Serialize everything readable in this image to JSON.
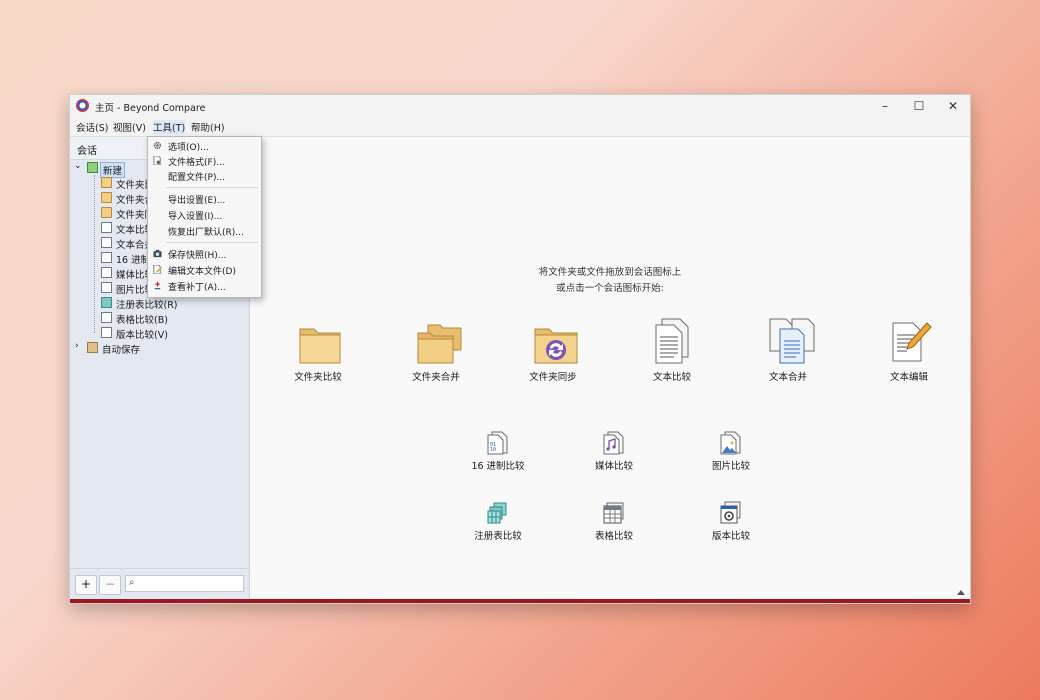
{
  "window": {
    "title": "主页 - Beyond Compare"
  },
  "menubar": {
    "items": [
      "会话(S)",
      "视图(V)",
      "工具(T)",
      "帮助(H)"
    ]
  },
  "tools_menu": {
    "items": [
      {
        "label": "选项(O)...",
        "icon": "gear-icon"
      },
      {
        "label": "文件格式(F)...",
        "icon": "file-format-icon"
      },
      {
        "label": "配置文件(P)...",
        "icon": ""
      },
      {
        "label": "导出设置(E)...",
        "icon": ""
      },
      {
        "label": "导入设置(I)...",
        "icon": ""
      },
      {
        "label": "恢复出厂默认(R)...",
        "icon": ""
      },
      {
        "label": "保存快照(H)...",
        "icon": "camera-icon"
      },
      {
        "label": "编辑文本文件(D)",
        "icon": "edit-file-icon"
      },
      {
        "label": "查看补丁(A)...",
        "icon": "patch-icon"
      }
    ]
  },
  "sidebar": {
    "header": "会话",
    "tree": {
      "new": "新建",
      "items": [
        "文件夹比较",
        "文件夹合并",
        "文件夹同步",
        "文本比较",
        "文本合并",
        "16 进制比较",
        "媒体比较",
        "图片比较",
        "注册表比较(R)",
        "表格比较(B)",
        "版本比较(V)"
      ],
      "autosave": "自动保存"
    },
    "add_label": "+",
    "remove_label": "−",
    "search_placeholder": ""
  },
  "main": {
    "hint_line1": "将文件夹或文件拖放到会话图标上",
    "hint_line2": "或点击一个会话图标开始:",
    "large_sessions": [
      "文件夹比较",
      "文件夹合并",
      "文件夹同步",
      "文本比较",
      "文本合并",
      "文本编辑"
    ],
    "small_sessions_row1": [
      "16 进制比较",
      "媒体比较",
      "图片比较"
    ],
    "small_sessions_row2": [
      "注册表比较",
      "表格比较",
      "版本比较"
    ]
  },
  "colors": {
    "accent_bar": "#a0161d",
    "selection": "#cfe0f6"
  }
}
